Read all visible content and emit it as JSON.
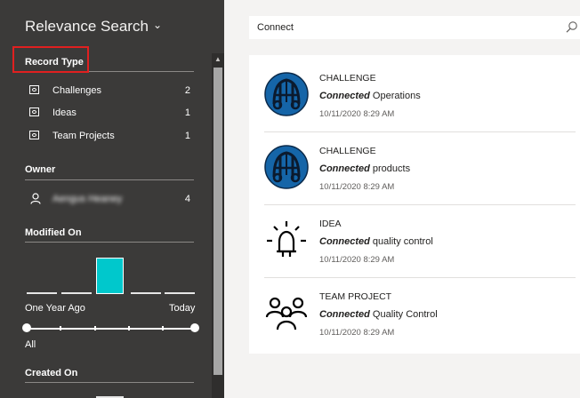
{
  "sidebar": {
    "title": "Relevance Search",
    "record_type": {
      "heading": "Record Type",
      "items": [
        {
          "label": "Challenges",
          "count": "2"
        },
        {
          "label": "Ideas",
          "count": "1"
        },
        {
          "label": "Team Projects",
          "count": "1"
        }
      ]
    },
    "owner": {
      "heading": "Owner",
      "items": [
        {
          "label": "Aengus Heaney",
          "count": "4"
        }
      ]
    },
    "modified_on": {
      "heading": "Modified On",
      "range_start": "One Year Ago",
      "range_end": "Today",
      "range_value": "All"
    },
    "created_on": {
      "heading": "Created On"
    }
  },
  "search": {
    "query": "Connect"
  },
  "results": [
    {
      "type": "CHALLENGE",
      "match": "Connected",
      "rest": " Operations",
      "date": "10/11/2020 8:29 AM",
      "icon": "challenge-logo-icon"
    },
    {
      "type": "CHALLENGE",
      "match": "Connected",
      "rest": " products",
      "date": "10/11/2020 8:29 AM",
      "icon": "challenge-logo-icon"
    },
    {
      "type": "IDEA",
      "match": "Connected",
      "rest": " quality control",
      "date": "10/11/2020 8:29 AM",
      "icon": "lightbulb-icon"
    },
    {
      "type": "TEAM PROJECT",
      "match": "Connected",
      "rest": " Quality Control",
      "date": "10/11/2020 8:29 AM",
      "icon": "team-icon"
    }
  ],
  "colors": {
    "sidebar_bg": "#3b3a39",
    "accent_teal": "#00c8cc",
    "highlight_red": "#e02020",
    "challenge_blue": "#1565a8"
  }
}
